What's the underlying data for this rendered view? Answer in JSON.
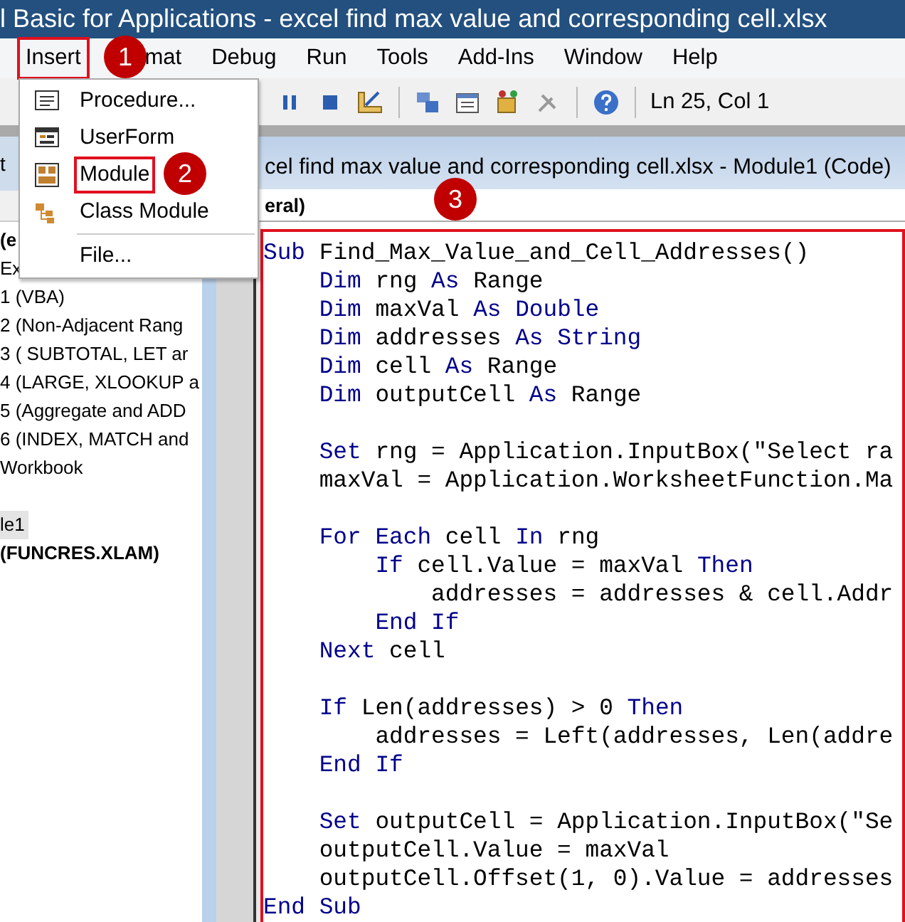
{
  "window": {
    "title": "l Basic for Applications - excel find max value and corresponding cell.xlsx"
  },
  "menu": [
    {
      "label": "Insert",
      "highlighted": true
    },
    {
      "label": "mat",
      "highlighted": false
    },
    {
      "label": "Debug",
      "highlighted": false
    },
    {
      "label": "Run",
      "highlighted": false
    },
    {
      "label": "Tools",
      "highlighted": false
    },
    {
      "label": "Add-Ins",
      "highlighted": false
    },
    {
      "label": "Window",
      "highlighted": false
    },
    {
      "label": "Help",
      "highlighted": false
    }
  ],
  "toolbar": {
    "position": "Ln 25, Col 1"
  },
  "insert_menu": [
    {
      "label": "Procedure...",
      "kind": "procedure",
      "highlighted": false
    },
    {
      "label": "UserForm",
      "kind": "userform",
      "highlighted": false
    },
    {
      "label": "Module",
      "kind": "module",
      "highlighted": true
    },
    {
      "label": "Class Module",
      "kind": "class",
      "highlighted": false
    },
    {
      "kind": "separator"
    },
    {
      "label": "File...",
      "kind": "file",
      "highlighted": false
    }
  ],
  "project_explorer": {
    "title": "t",
    "items": [
      {
        "kind": "item",
        "label": "(e",
        "bold": true,
        "selected": false
      },
      {
        "kind": "item",
        "label": "Ex",
        "bold": false,
        "selected": false
      },
      {
        "kind": "item",
        "label": "1 (VBA)",
        "bold": false,
        "selected": false
      },
      {
        "kind": "item",
        "label": "2 (Non-Adjacent Rang",
        "bold": false,
        "selected": false
      },
      {
        "kind": "item",
        "label": "3 ( SUBTOTAL, LET ar",
        "bold": false,
        "selected": false
      },
      {
        "kind": "item",
        "label": "4 (LARGE, XLOOKUP a",
        "bold": false,
        "selected": false
      },
      {
        "kind": "item",
        "label": "5 (Aggregate and ADD",
        "bold": false,
        "selected": false
      },
      {
        "kind": "item",
        "label": "6 (INDEX, MATCH and",
        "bold": false,
        "selected": false
      },
      {
        "kind": "item",
        "label": "Workbook",
        "bold": false,
        "selected": false
      },
      {
        "kind": "blank"
      },
      {
        "kind": "item",
        "label": "le1",
        "bold": false,
        "selected": true
      },
      {
        "kind": "item",
        "label": "(FUNCRES.XLAM)",
        "bold": true,
        "selected": false
      }
    ]
  },
  "code_window": {
    "title": "cel find max value and corresponding cell.xlsx - Module1 (Code)",
    "object_box": "eral)",
    "highlighted": true,
    "lines": [
      {
        "kind": "code",
        "segments": [
          {
            "text": "Sub",
            "keyword": true
          },
          {
            "text": " Find_Max_Value_and_Cell_Addresses()",
            "keyword": false
          }
        ]
      },
      {
        "kind": "code",
        "segments": [
          {
            "text": "    Dim",
            "keyword": true
          },
          {
            "text": " rng ",
            "keyword": false
          },
          {
            "text": "As",
            "keyword": true
          },
          {
            "text": " Range",
            "keyword": false
          }
        ]
      },
      {
        "kind": "code",
        "segments": [
          {
            "text": "    Dim",
            "keyword": true
          },
          {
            "text": " maxVal ",
            "keyword": false
          },
          {
            "text": "As Double",
            "keyword": true
          }
        ]
      },
      {
        "kind": "code",
        "segments": [
          {
            "text": "    Dim",
            "keyword": true
          },
          {
            "text": " addresses ",
            "keyword": false
          },
          {
            "text": "As String",
            "keyword": true
          }
        ]
      },
      {
        "kind": "code",
        "segments": [
          {
            "text": "    Dim",
            "keyword": true
          },
          {
            "text": " cell ",
            "keyword": false
          },
          {
            "text": "As",
            "keyword": true
          },
          {
            "text": " Range",
            "keyword": false
          }
        ]
      },
      {
        "kind": "code",
        "segments": [
          {
            "text": "    Dim",
            "keyword": true
          },
          {
            "text": " outputCell ",
            "keyword": false
          },
          {
            "text": "As",
            "keyword": true
          },
          {
            "text": " Range",
            "keyword": false
          }
        ]
      },
      {
        "kind": "blank"
      },
      {
        "kind": "code",
        "segments": [
          {
            "text": "    Set",
            "keyword": true
          },
          {
            "text": " rng = Application.InputBox(\"Select ra",
            "keyword": false
          }
        ]
      },
      {
        "kind": "code",
        "segments": [
          {
            "text": "    maxVal = Application.WorksheetFunction.Ma",
            "keyword": false
          }
        ]
      },
      {
        "kind": "blank"
      },
      {
        "kind": "code",
        "segments": [
          {
            "text": "    For Each",
            "keyword": true
          },
          {
            "text": " cell ",
            "keyword": false
          },
          {
            "text": "In",
            "keyword": true
          },
          {
            "text": " rng",
            "keyword": false
          }
        ]
      },
      {
        "kind": "code",
        "segments": [
          {
            "text": "        If",
            "keyword": true
          },
          {
            "text": " cell.Value = maxVal ",
            "keyword": false
          },
          {
            "text": "Then",
            "keyword": true
          }
        ]
      },
      {
        "kind": "code",
        "segments": [
          {
            "text": "            addresses = addresses & cell.Addr",
            "keyword": false
          }
        ]
      },
      {
        "kind": "code",
        "segments": [
          {
            "text": "        End If",
            "keyword": true
          }
        ]
      },
      {
        "kind": "code",
        "segments": [
          {
            "text": "    Next",
            "keyword": true
          },
          {
            "text": " cell",
            "keyword": false
          }
        ]
      },
      {
        "kind": "blank"
      },
      {
        "kind": "code",
        "segments": [
          {
            "text": "    If",
            "keyword": true
          },
          {
            "text": " Len(addresses) > 0 ",
            "keyword": false
          },
          {
            "text": "Then",
            "keyword": true
          }
        ]
      },
      {
        "kind": "code",
        "segments": [
          {
            "text": "        addresses = Left(addresses, Len(addre",
            "keyword": false
          }
        ]
      },
      {
        "kind": "code",
        "segments": [
          {
            "text": "    End If",
            "keyword": true
          }
        ]
      },
      {
        "kind": "blank"
      },
      {
        "kind": "code",
        "segments": [
          {
            "text": "    Set",
            "keyword": true
          },
          {
            "text": " outputCell = Application.InputBox(\"Se",
            "keyword": false
          }
        ]
      },
      {
        "kind": "code",
        "segments": [
          {
            "text": "    outputCell.Value = maxVal",
            "keyword": false
          }
        ]
      },
      {
        "kind": "code",
        "segments": [
          {
            "text": "    outputCell.Offset(1, 0).Value = addresses",
            "keyword": false
          }
        ]
      },
      {
        "kind": "code",
        "segments": [
          {
            "text": "End Sub",
            "keyword": true
          }
        ]
      }
    ]
  },
  "callouts": [
    "1",
    "2",
    "3"
  ]
}
